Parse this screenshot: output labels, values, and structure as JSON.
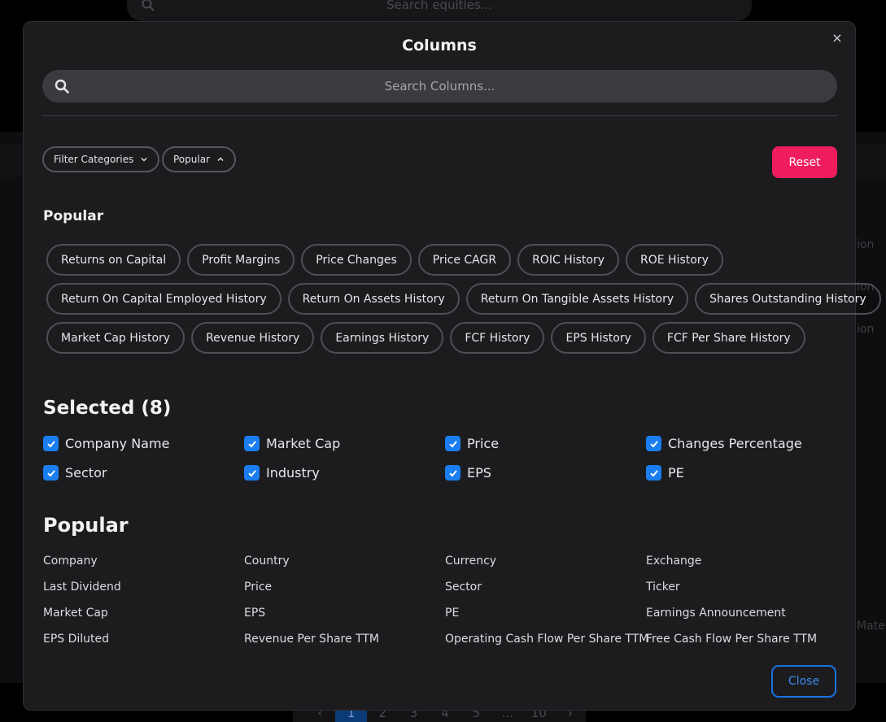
{
  "background": {
    "search_placeholder": "Search equities...",
    "side_texts": [
      "ion",
      "ion",
      "ion"
    ],
    "side_text_right": "Mate",
    "pagination": [
      "‹",
      "1",
      "2",
      "3",
      "4",
      "5",
      "...",
      "10",
      "›"
    ]
  },
  "modal": {
    "title": "Columns",
    "close_icon": "×",
    "search_placeholder": "Search Columns...",
    "filters": {
      "filter_categories_label": "Filter Categories",
      "popular_label": "Popular"
    },
    "reset_label": "Reset",
    "popular_heading": "Popular",
    "chip_rows": [
      [
        "Returns on Capital",
        "Profit Margins",
        "Price Changes",
        "Price CAGR",
        "ROIC History",
        "ROE History"
      ],
      [
        "Return On Capital Employed History",
        "Return On Assets History",
        "Return On Tangible Assets History",
        "Shares Outstanding History"
      ],
      [
        "Market Cap History",
        "Revenue History",
        "Earnings History",
        "FCF History",
        "EPS History",
        "FCF Per Share History"
      ]
    ],
    "selected_heading": "Selected (8)",
    "selected_items": [
      "Company Name",
      "Market Cap",
      "Price",
      "Changes Percentage",
      "Sector",
      "Industry",
      "EPS",
      "PE"
    ],
    "popular_list_heading": "Popular",
    "popular_list": [
      "Company",
      "Country",
      "Currency",
      "Exchange",
      "Last Dividend",
      "Price",
      "Sector",
      "Ticker",
      "Market Cap",
      "EPS",
      "PE",
      "Earnings Announcement",
      "EPS Diluted",
      "Revenue Per Share TTM",
      "Operating Cash Flow Per Share TTM",
      "Free Cash Flow Per Share TTM"
    ],
    "close_label": "Close"
  },
  "colors": {
    "accent_blue": "#1a7ef0",
    "reset_pink": "#ef1d5e",
    "modal_bg": "#1c1c1f"
  }
}
